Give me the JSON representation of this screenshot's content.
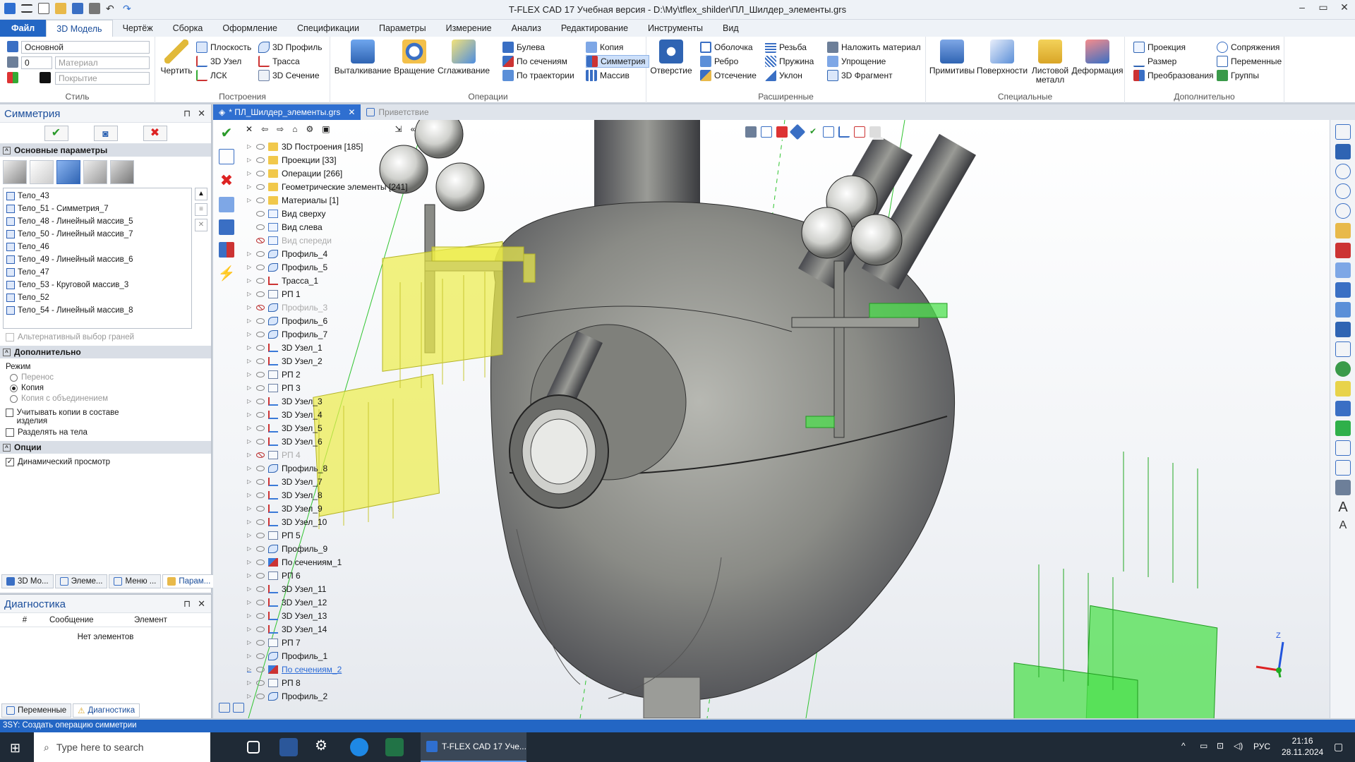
{
  "window": {
    "title": "T-FLEX CAD 17 Учебная версия - D:\\My\\tflex_shilder\\ПЛ_Шилдер_элементы.grs"
  },
  "tabs": [
    "Файл",
    "3D Модель",
    "Чертёж",
    "Сборка",
    "Оформление",
    "Спецификации",
    "Параметры",
    "Измерение",
    "Анализ",
    "Редактирование",
    "Инструменты",
    "Вид"
  ],
  "ribbon": {
    "style": {
      "layer": "Основной",
      "level": "0",
      "material": "Материал",
      "coating": "Покрытие",
      "label": "Стиль"
    },
    "constructions": {
      "draw": "Чертить",
      "plane": "Плоскость",
      "node3d": "3D Узел",
      "lsk": "ЛСК",
      "profile3d": "3D Профиль",
      "path": "Трасса",
      "section3d": "3D Сечение",
      "label": "Построения"
    },
    "operations": {
      "extrude": "Выталкивание",
      "rotate": "Вращение",
      "smooth": "Сглаживание",
      "boolean": "Булева",
      "bysections": "По сечениям",
      "bypath": "По траектории",
      "copy": "Копия",
      "symmetry": "Симметрия",
      "array": "Массив",
      "label": "Операции"
    },
    "extended": {
      "hole": "Отверстие",
      "shell": "Оболочка",
      "rib": "Ребро",
      "cut": "Отсечение",
      "thread": "Резьба",
      "spring": "Пружина",
      "slope": "Уклон",
      "material": "Наложить материал",
      "simplify": "Упрощение",
      "fragment3d": "3D Фрагмент",
      "label": "Расширенные"
    },
    "special": {
      "primitives": "Примитивы",
      "surfaces": "Поверхности",
      "sheetmetal": "Листовой металл",
      "deform": "Деформация",
      "label": "Специальные"
    },
    "extra": {
      "projection": "Проекция",
      "size": "Размер",
      "transform": "Преобразования",
      "mates": "Сопряжения",
      "variables": "Переменные",
      "groups": "Группы",
      "label": "Дополнительно"
    }
  },
  "leftpanel": {
    "title": "Симметрия",
    "section_main": "Основные параметры",
    "bodies": [
      "Тело_43",
      "Тело_51 - Симметрия_7",
      "Тело_48 - Линейный массив_5",
      "Тело_50 - Линейный массив_7",
      "Тело_46",
      "Тело_49 - Линейный массив_6",
      "Тело_47",
      "Тело_53 - Круговой массив_3",
      "Тело_52",
      "Тело_54 - Линейный массив_8"
    ],
    "alt_faces": "Альтернативный выбор граней",
    "section_extra": "Дополнительно",
    "mode_label": "Режим",
    "modes": [
      "Перенос",
      "Копия",
      "Копия с объединением"
    ],
    "consider_copies": "Учитывать копии в составе изделия",
    "split_bodies": "Разделять на тела",
    "section_options": "Опции",
    "dynamic_preview": "Динамический просмотр",
    "bottom_tabs": [
      "3D Мо...",
      "Элеме...",
      "Меню ...",
      "Парам..."
    ]
  },
  "diagnostics": {
    "title": "Диагностика",
    "col_num": "#",
    "col_msg": "Сообщение",
    "col_el": "Элемент",
    "empty": "Нет элементов",
    "tabs": [
      "Переменные",
      "Диагностика"
    ]
  },
  "doctabs": {
    "active": "* ПЛ_Шилдер_элементы.grs",
    "welcome": "Приветствие"
  },
  "tree": [
    {
      "t": "3D Построения [185]",
      "i": "folder",
      "arrow": true
    },
    {
      "t": "Проекции [33]",
      "i": "folder",
      "arrow": true
    },
    {
      "t": "Операции [266]",
      "i": "folder",
      "arrow": true
    },
    {
      "t": "Геометрические элементы [241]",
      "i": "folder",
      "arrow": true
    },
    {
      "t": "Материалы [1]",
      "i": "folder",
      "arrow": true
    },
    {
      "t": "Вид сверху",
      "i": "page"
    },
    {
      "t": "Вид слева",
      "i": "page"
    },
    {
      "t": "Вид спереди",
      "i": "page",
      "dim": true
    },
    {
      "t": "Профиль_4",
      "i": "prof",
      "arrow": true
    },
    {
      "t": "Профиль_5",
      "i": "prof",
      "arrow": true
    },
    {
      "t": "Трасса_1",
      "i": "path",
      "arrow": true
    },
    {
      "t": "РП 1",
      "i": "rp",
      "arrow": true
    },
    {
      "t": "Профиль_3",
      "i": "prof",
      "arrow": true,
      "dim": true
    },
    {
      "t": "Профиль_6",
      "i": "prof",
      "arrow": true
    },
    {
      "t": "Профиль_7",
      "i": "prof",
      "arrow": true
    },
    {
      "t": "3D Узел_1",
      "i": "node",
      "arrow": true
    },
    {
      "t": "3D Узел_2",
      "i": "node",
      "arrow": true
    },
    {
      "t": "РП 2",
      "i": "rp",
      "arrow": true
    },
    {
      "t": "РП 3",
      "i": "rp",
      "arrow": true
    },
    {
      "t": "3D Узел_3",
      "i": "node",
      "arrow": true
    },
    {
      "t": "3D Узел_4",
      "i": "node",
      "arrow": true
    },
    {
      "t": "3D Узел_5",
      "i": "node",
      "arrow": true
    },
    {
      "t": "3D Узел_6",
      "i": "node",
      "arrow": true
    },
    {
      "t": "РП 4",
      "i": "rp",
      "arrow": true,
      "dim": true
    },
    {
      "t": "Профиль_8",
      "i": "prof",
      "arrow": true
    },
    {
      "t": "3D Узел_7",
      "i": "node",
      "arrow": true
    },
    {
      "t": "3D Узел_8",
      "i": "node",
      "arrow": true
    },
    {
      "t": "3D Узел_9",
      "i": "node",
      "arrow": true
    },
    {
      "t": "3D Узел_10",
      "i": "node",
      "arrow": true
    },
    {
      "t": "РП 5",
      "i": "rp",
      "arrow": true
    },
    {
      "t": "Профиль_9",
      "i": "prof",
      "arrow": true
    },
    {
      "t": "По сечениям_1",
      "i": "sec",
      "arrow": true
    },
    {
      "t": "РП 6",
      "i": "rp",
      "arrow": true
    },
    {
      "t": "3D Узел_11",
      "i": "node",
      "arrow": true
    },
    {
      "t": "3D Узел_12",
      "i": "node",
      "arrow": true
    },
    {
      "t": "3D Узел_13",
      "i": "node",
      "arrow": true
    },
    {
      "t": "3D Узел_14",
      "i": "node",
      "arrow": true
    },
    {
      "t": "РП 7",
      "i": "rp",
      "arrow": true
    },
    {
      "t": "Профиль_1",
      "i": "prof",
      "arrow": true
    },
    {
      "t": "По сечениям_2",
      "i": "sec",
      "arrow": true,
      "link": true
    },
    {
      "t": "РП 8",
      "i": "rp",
      "arrow": true
    },
    {
      "t": "Профиль_2",
      "i": "prof",
      "arrow": true
    }
  ],
  "axes": {
    "z": "Z"
  },
  "status": "3SY: Создать операцию симметрии",
  "taskbar": {
    "search": "Type here to search",
    "app": "T-FLEX CAD 17 Уче...",
    "lang": "РУС",
    "time": "21:16",
    "date": "28.11.2024"
  },
  "colors": {
    "accent": "#2366c4",
    "yellow_preview": "#e6e62a",
    "green_preview": "#45d945",
    "hull": "#8a8b86"
  }
}
